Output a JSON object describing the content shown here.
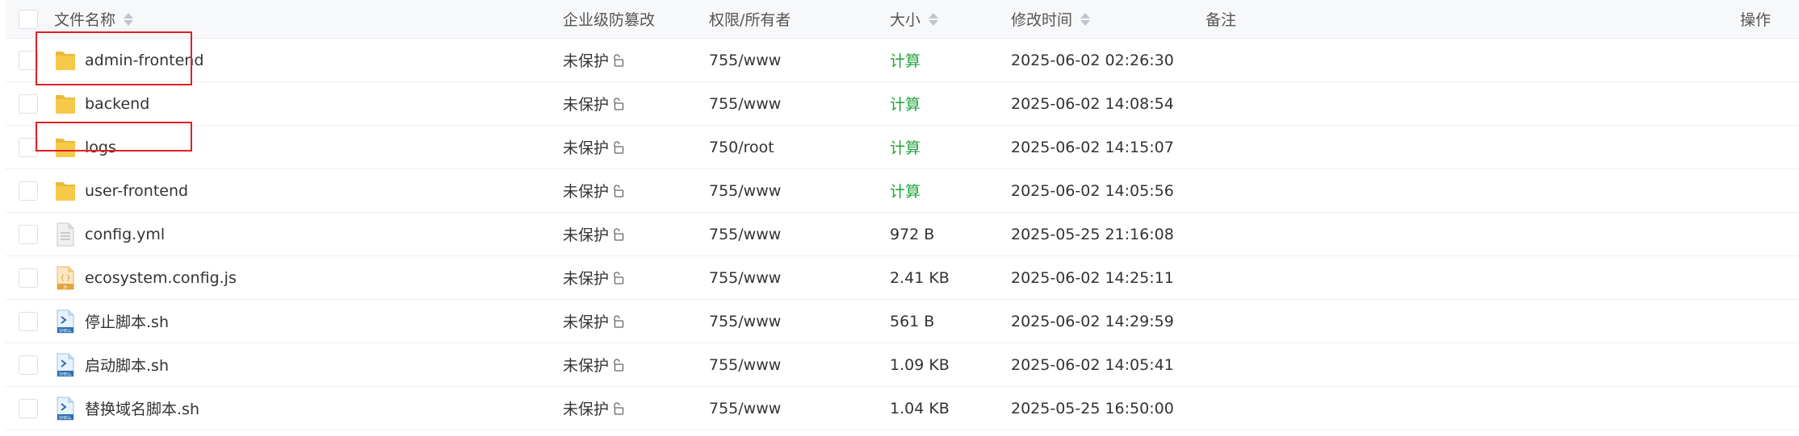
{
  "header": {
    "name": "文件名称",
    "protect": "企业级防篡改",
    "perm": "权限/所有者",
    "size": "大小",
    "mtime": "修改时间",
    "note": "备注",
    "ops": "操作"
  },
  "rows": [
    {
      "name": "admin-frontend",
      "icon": "folder-icon",
      "protect": "未保护",
      "perm": "755/www",
      "size": "计算",
      "mtime": "2025-06-02 02:26:30"
    },
    {
      "name": "backend",
      "icon": "folder-icon",
      "protect": "未保护",
      "perm": "755/www",
      "size": "计算",
      "mtime": "2025-06-02 14:08:54"
    },
    {
      "name": "logs",
      "icon": "folder-icon",
      "protect": "未保护",
      "perm": "750/root",
      "size": "计算",
      "mtime": "2025-06-02 14:15:07"
    },
    {
      "name": "user-frontend",
      "icon": "folder-icon",
      "protect": "未保护",
      "perm": "755/www",
      "size": "计算",
      "mtime": "2025-06-02 14:05:56"
    },
    {
      "name": "config.yml",
      "icon": "text-file-icon",
      "protect": "未保护",
      "perm": "755/www",
      "size": "972 B",
      "mtime": "2025-05-25 21:16:08"
    },
    {
      "name": "ecosystem.config.js",
      "icon": "js-file-icon",
      "protect": "未保护",
      "perm": "755/www",
      "size": "2.41 KB",
      "mtime": "2025-06-02 14:25:11"
    },
    {
      "name": "停止脚本.sh",
      "icon": "shell-file-icon",
      "protect": "未保护",
      "perm": "755/www",
      "size": "561 B",
      "mtime": "2025-06-02 14:29:59"
    },
    {
      "name": "启动脚本.sh",
      "icon": "shell-file-icon",
      "protect": "未保护",
      "perm": "755/www",
      "size": "1.09 KB",
      "mtime": "2025-06-02 14:05:41"
    },
    {
      "name": "替换域名脚本.sh",
      "icon": "shell-file-icon",
      "protect": "未保护",
      "perm": "755/www",
      "size": "1.04 KB",
      "mtime": "2025-05-25 16:50:00"
    }
  ],
  "colors": {
    "calc": "#20a53a",
    "highlight": "#e02020",
    "folder": "#f7c948"
  }
}
